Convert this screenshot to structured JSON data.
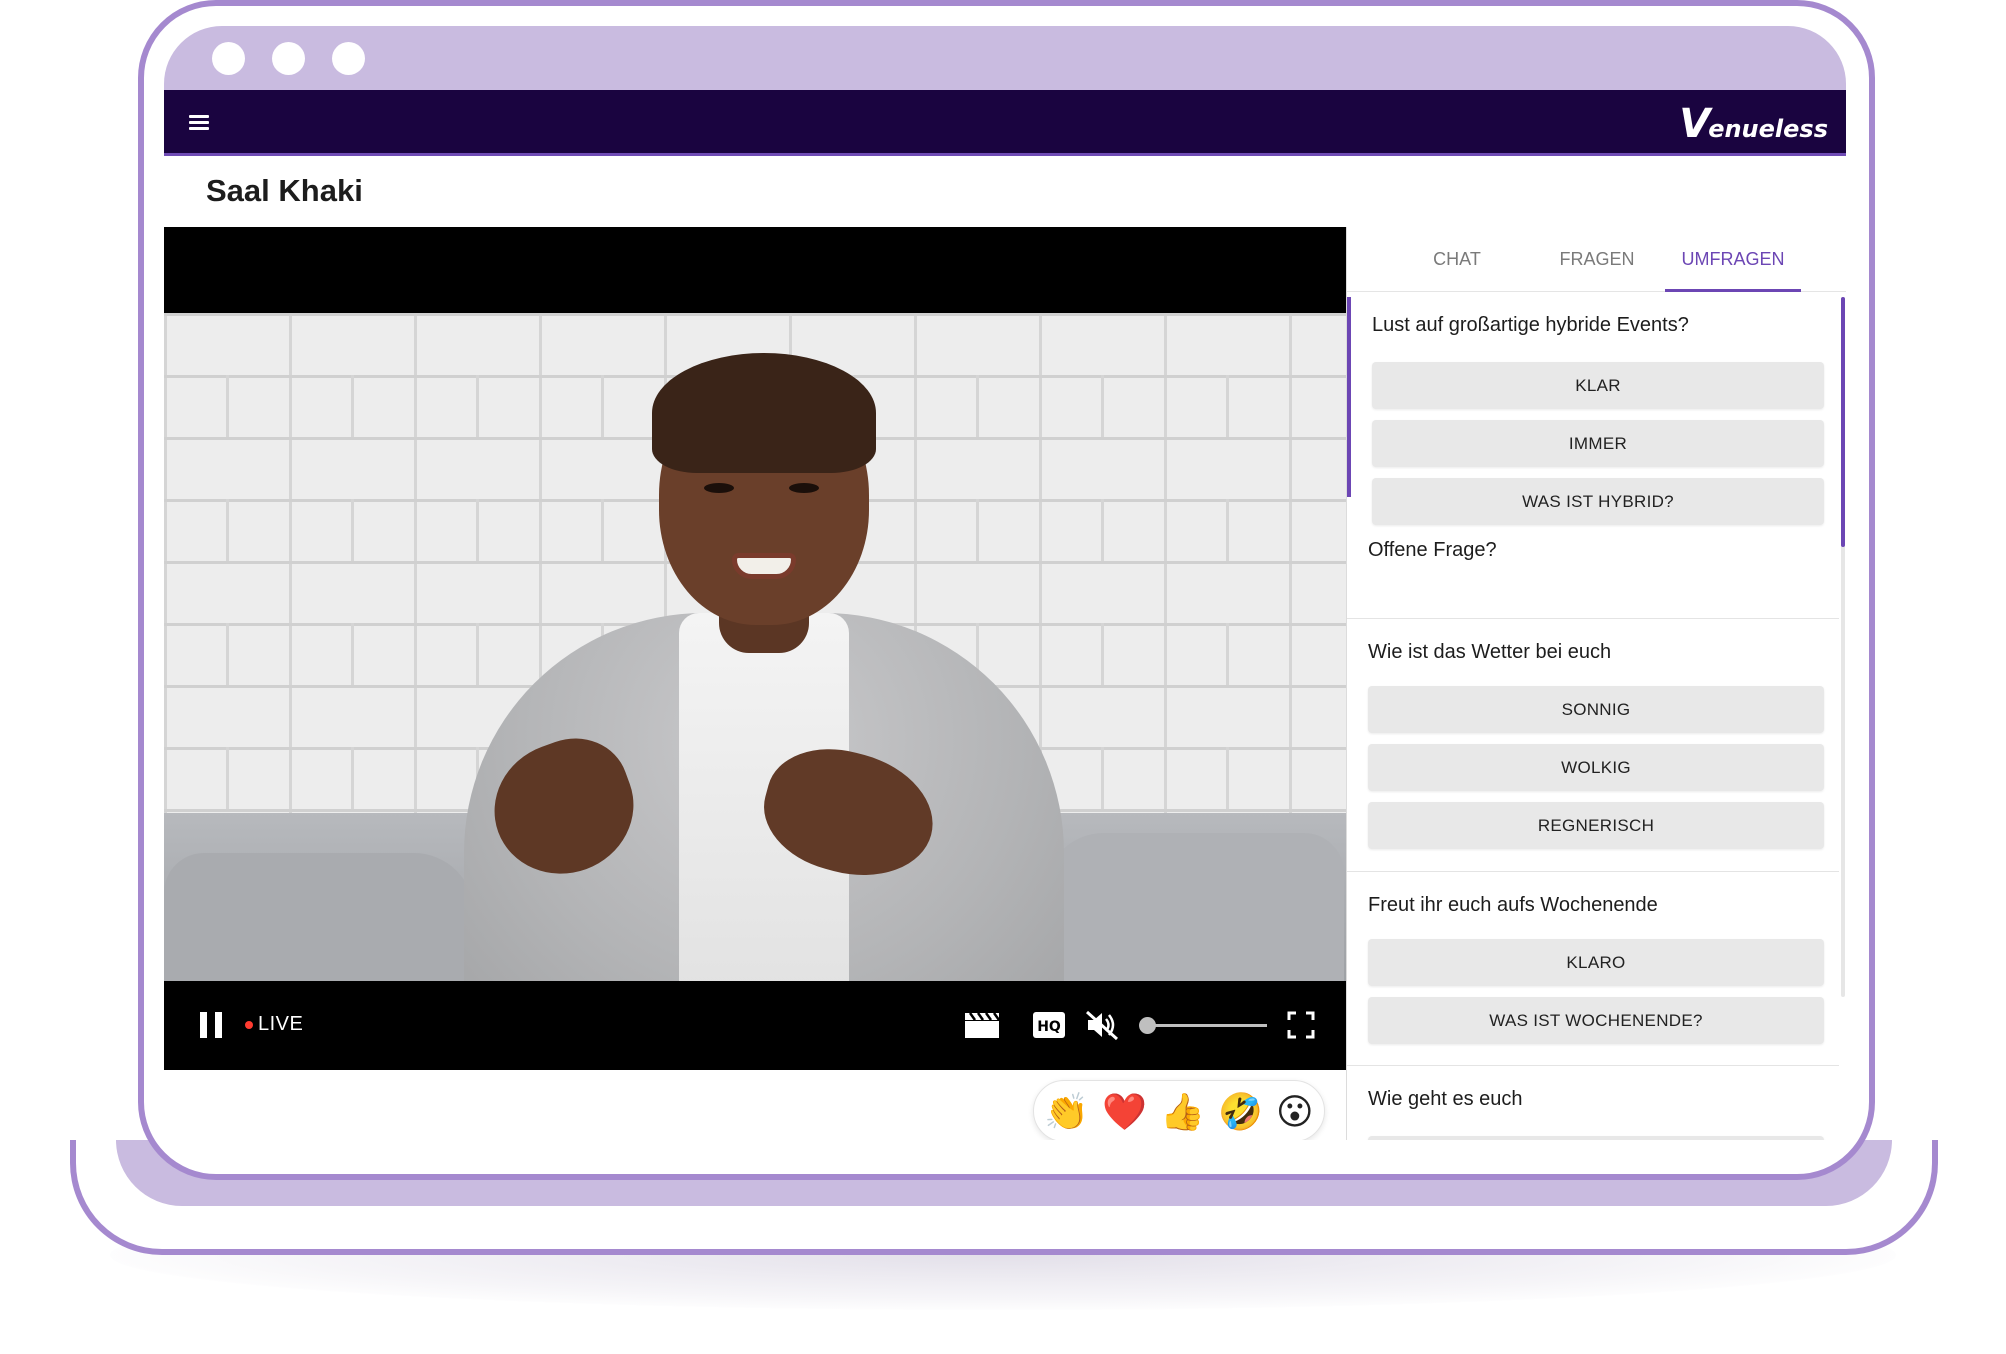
{
  "app": {
    "logo_initial": "V",
    "logo_rest": "enueless",
    "accent_color": "#6c46b4",
    "header_color": "#1a0440",
    "frame_color": "#c9bbe0"
  },
  "room": {
    "title": "Saal Khaki"
  },
  "player": {
    "live_label": "LIVE",
    "volume_level": 0,
    "icons": [
      "pause-icon",
      "clapper-icon",
      "hq-icon",
      "mute-icon",
      "fullscreen-icon"
    ]
  },
  "reactions": {
    "items": [
      {
        "name": "clap",
        "glyph": "👏"
      },
      {
        "name": "heart",
        "glyph": "❤️"
      },
      {
        "name": "thumbs-up",
        "glyph": "👍"
      },
      {
        "name": "rofl",
        "glyph": "🤣"
      },
      {
        "name": "surprised",
        "glyph": "😮"
      }
    ]
  },
  "sidebar": {
    "tabs": [
      {
        "label": "CHAT",
        "active": false
      },
      {
        "label": "FRAGEN",
        "active": false
      },
      {
        "label": "UMFRAGEN",
        "active": true
      }
    ],
    "polls": [
      {
        "question": "Lust auf großartige hybride Events?",
        "options": [
          "Klar",
          "Immer",
          "Was ist hybrid?"
        ],
        "active": true
      },
      {
        "question": "Offene Frage?",
        "options": []
      },
      {
        "question": "Wie ist das Wetter bei euch",
        "options": [
          "Sonnig",
          "Wolkig",
          "Regnerisch"
        ]
      },
      {
        "question": "Freut ihr euch aufs Wochenende",
        "options": [
          "Klaro",
          "Was ist Wochenende?"
        ]
      },
      {
        "question": "Wie geht es euch",
        "options": []
      }
    ]
  }
}
